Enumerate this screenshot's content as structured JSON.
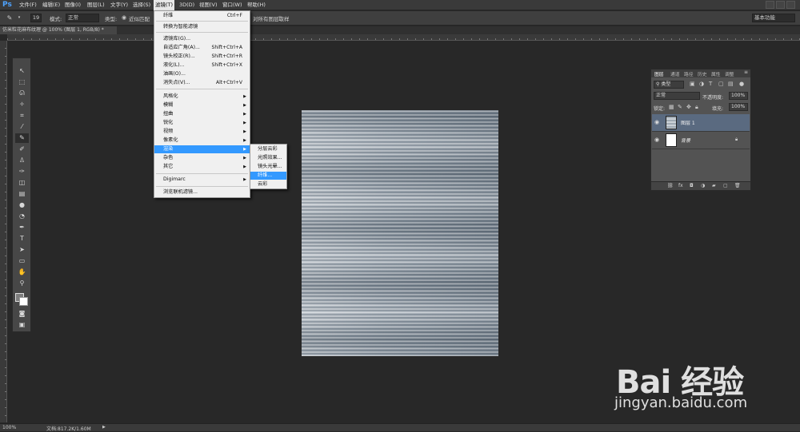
{
  "app": {
    "logo": "Ps"
  },
  "menubar": {
    "items": [
      "文件(F)",
      "编辑(E)",
      "图像(I)",
      "图层(L)",
      "文字(Y)",
      "选择(S)",
      "滤镜(T)",
      "3D(D)",
      "视图(V)",
      "窗口(W)",
      "帮助(H)"
    ]
  },
  "options": {
    "mode_label": "模式:",
    "mode_value": "正常",
    "type_label": "类型:",
    "proximity_label": "近似匹配",
    "brush_size": "19",
    "all_layers_label": "对所有图层取样",
    "workspace": "基本功能"
  },
  "document": {
    "tab_title": "仿米粒花麻布纹理 @ 100% (图层 1, RGB/8) *"
  },
  "filter_menu": {
    "items": [
      {
        "label": "纤维",
        "shortcut": "Ctrl+F"
      },
      {
        "label": "转换为智能滤镜"
      },
      {
        "label": "滤镜库(G)..."
      },
      {
        "label": "自适应广角(A)...",
        "shortcut": "Shift+Ctrl+A"
      },
      {
        "label": "镜头校正(R)...",
        "shortcut": "Shift+Ctrl+R"
      },
      {
        "label": "液化(L)...",
        "shortcut": "Shift+Ctrl+X"
      },
      {
        "label": "油画(O)..."
      },
      {
        "label": "消失点(V)...",
        "shortcut": "Alt+Ctrl+V"
      },
      {
        "label": "风格化",
        "submenu": true
      },
      {
        "label": "模糊",
        "submenu": true
      },
      {
        "label": "扭曲",
        "submenu": true
      },
      {
        "label": "锐化",
        "submenu": true
      },
      {
        "label": "视频",
        "submenu": true
      },
      {
        "label": "像素化",
        "submenu": true
      },
      {
        "label": "渲染",
        "submenu": true,
        "highlighted": true
      },
      {
        "label": "杂色",
        "submenu": true
      },
      {
        "label": "其它",
        "submenu": true
      },
      {
        "label": "Digimarc",
        "submenu": true
      },
      {
        "label": "浏览联机滤镜..."
      }
    ]
  },
  "render_submenu": {
    "items": [
      {
        "label": "分层云彩"
      },
      {
        "label": "光照效果..."
      },
      {
        "label": "镜头光晕..."
      },
      {
        "label": "纤维...",
        "highlighted": true
      },
      {
        "label": "云彩"
      }
    ]
  },
  "layers_panel": {
    "tabs": [
      "图层",
      "通道",
      "路径",
      "历史",
      "属性",
      "调整"
    ],
    "kind_label": "类型",
    "blend_mode": "正常",
    "opacity_label": "不透明度:",
    "opacity_value": "100%",
    "lock_label": "锁定:",
    "fill_label": "填充:",
    "fill_value": "100%",
    "layers": [
      {
        "name": "图层 1",
        "selected": true
      },
      {
        "name": "背景",
        "locked": true
      }
    ]
  },
  "status": {
    "zoom": "100%",
    "doc_info": "文档:817.2K/1.60M"
  },
  "watermark": {
    "brand": "Bai  经验",
    "url": "jingyan.baidu.com"
  }
}
